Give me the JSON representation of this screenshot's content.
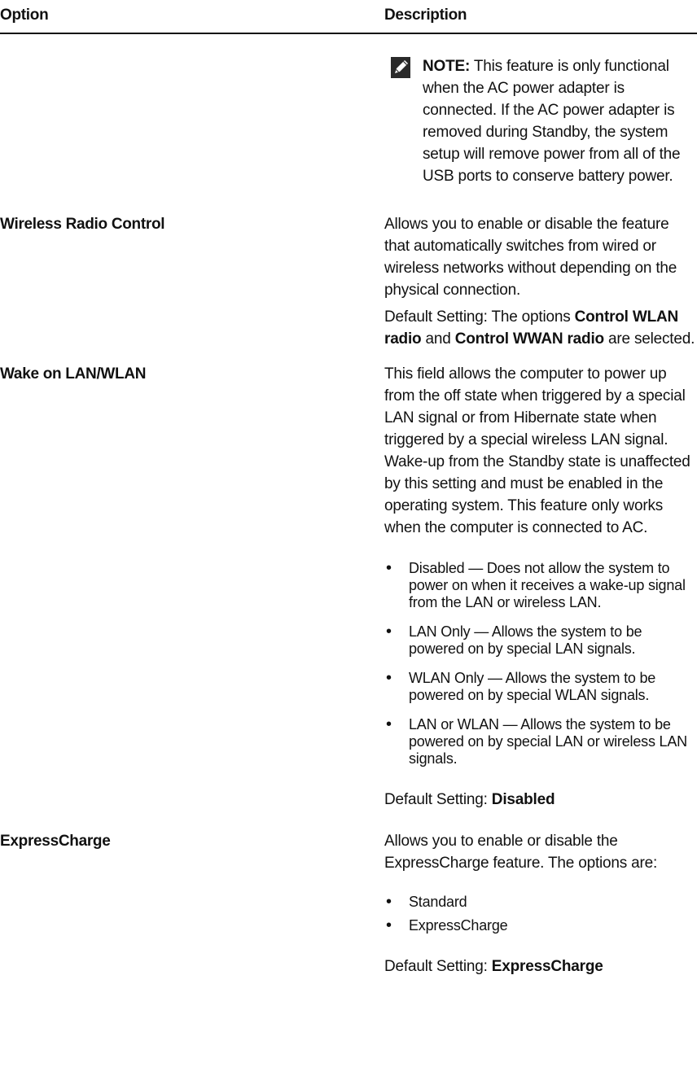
{
  "header": {
    "option_label": "Option",
    "description_label": "Description"
  },
  "note": {
    "label": "NOTE:",
    "text": " This feature is only functional when the AC power adapter is connected. If the AC power adapter is removed during Standby, the system setup will remove power from all of the USB ports to conserve battery power."
  },
  "rows": [
    {
      "option": "Wireless Radio Control",
      "description": "Allows you to enable or disable the feature that automatically switches from wired or wireless networks without depending on the physical connection.",
      "default_prefix": "Default Setting: The options ",
      "default_bold1": "Control WLAN radio",
      "default_mid": " and ",
      "default_bold2": "Control WWAN radio",
      "default_suffix": " are selected."
    },
    {
      "option": "Wake on LAN/WLAN",
      "description": "This field allows the computer to power up from the off state when triggered by a special LAN signal or from Hibernate state when triggered by a special wireless LAN signal. Wake-up from the Standby state is unaffected by this setting and must be enabled in the operating system. This feature only works when the computer is connected to AC.",
      "bullets": [
        "Disabled — Does not allow the system to power on when it receives a wake-up signal from the LAN or wireless LAN.",
        "LAN Only — Allows the system to be powered on by special LAN signals.",
        "WLAN Only — Allows the system to be powered on by special WLAN signals.",
        "LAN or WLAN — Allows the system to be powered on by special LAN or wireless LAN signals."
      ],
      "default_prefix": "Default Setting: ",
      "default_value": "Disabled"
    },
    {
      "option": "ExpressCharge",
      "description": "Allows you to enable or disable the ExpressCharge feature. The options are:",
      "bullets": [
        "Standard",
        "ExpressCharge"
      ],
      "default_prefix": "Default Setting: ",
      "default_value": "ExpressCharge"
    }
  ],
  "icons": {
    "note_icon": "pencil-note-icon",
    "bullet_glyph": "•"
  }
}
